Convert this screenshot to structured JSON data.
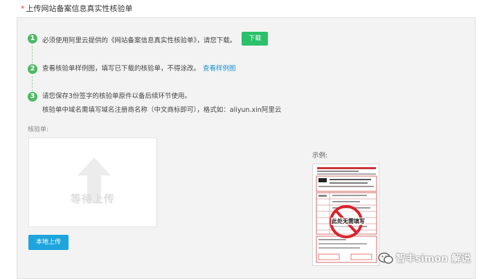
{
  "header": {
    "required_mark": "*",
    "title": "上传网站备案信息真实性核验单"
  },
  "steps": [
    {
      "number": "1",
      "text": "必须使用阿里云提供的《网站备案信息真实性核验单》，请您下载。",
      "button_label": "下载"
    },
    {
      "number": "2",
      "text": "查看核验单样例图，填写已下载的核验单，不得涂改。",
      "link_label": "查看样例图"
    },
    {
      "number": "3",
      "text": "请您保存3份签字的核验单原件以备后续环节使用。",
      "sub_text": "核验单中域名需填写域名注册商名称（中文商标即可），格式如：aliyun.xin阿里云"
    }
  ],
  "form": {
    "label": "核验单:",
    "upload_placeholder": "等待上传",
    "local_upload_label": "本地上传"
  },
  "example": {
    "label": "示例:",
    "stamp_text": "此处无需填写"
  },
  "watermark": {
    "text": "智丰simon 解说"
  },
  "colors": {
    "step_green": "#4cb963",
    "download_green": "#2bc06a",
    "link_blue": "#1a8fd3",
    "upload_blue": "#1ea5de",
    "required_red": "#e4393c",
    "prohibit_red": "#d9232d"
  }
}
